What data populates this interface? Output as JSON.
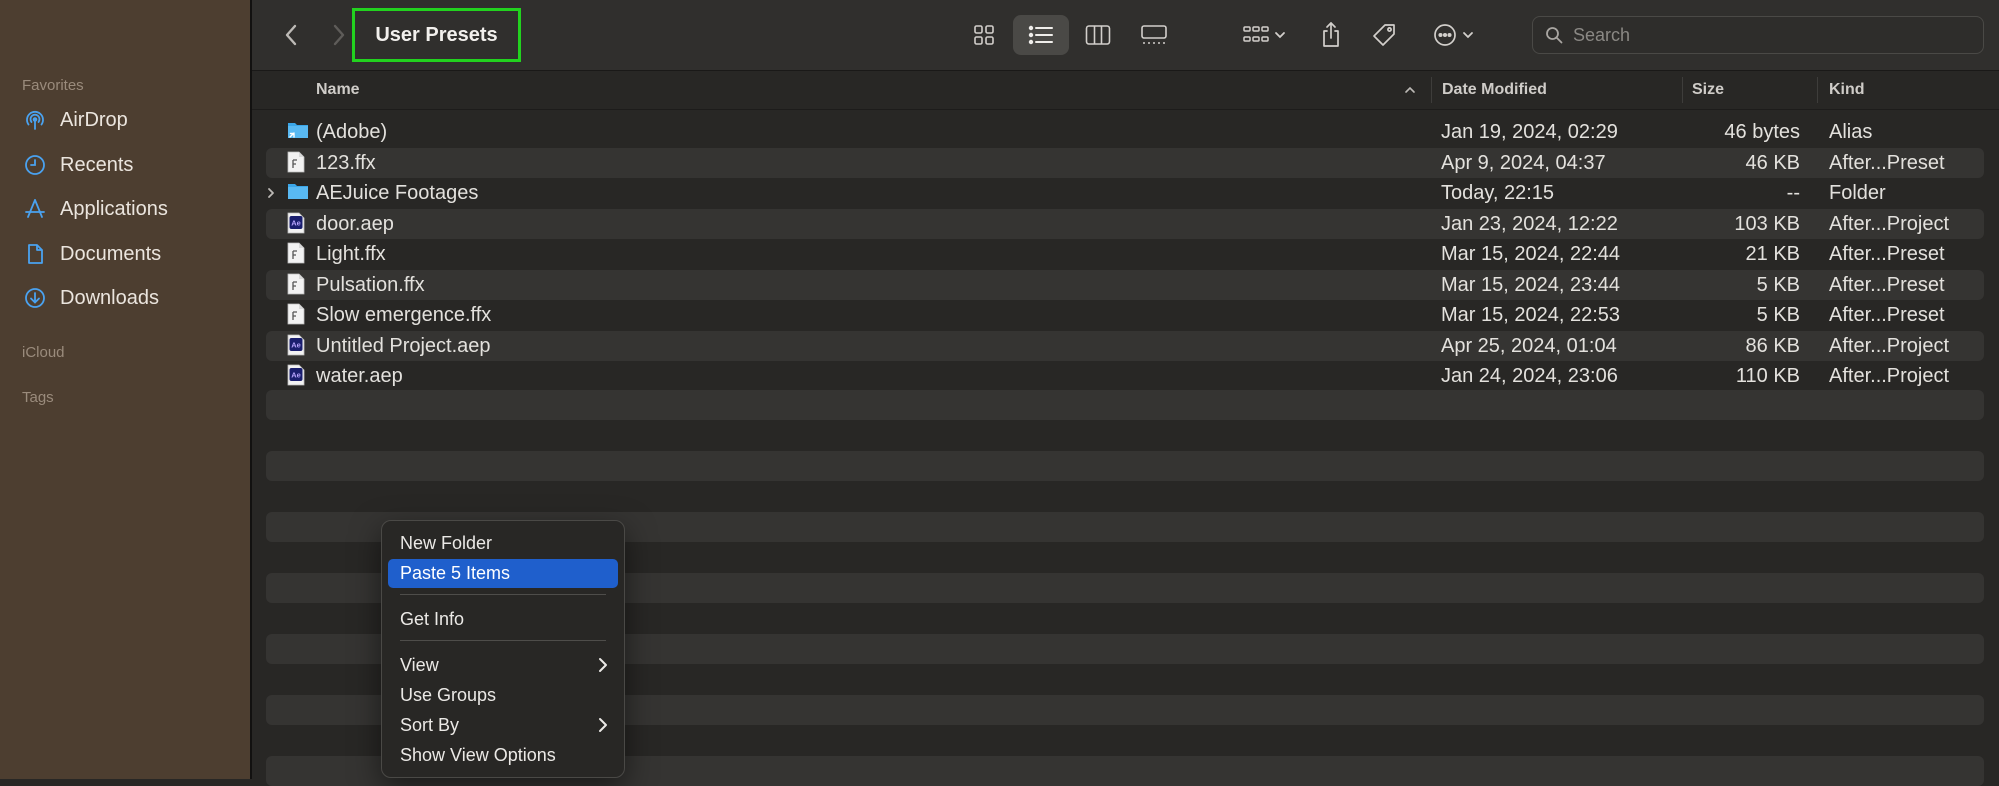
{
  "window": {
    "title": "User Presets"
  },
  "sidebar": {
    "sections": [
      {
        "label": "Favorites"
      },
      {
        "label": "iCloud"
      },
      {
        "label": "Tags"
      }
    ],
    "items": [
      {
        "label": "AirDrop",
        "icon": "airdrop-icon"
      },
      {
        "label": "Recents",
        "icon": "clock-icon"
      },
      {
        "label": "Applications",
        "icon": "applications-icon"
      },
      {
        "label": "Documents",
        "icon": "document-icon"
      },
      {
        "label": "Downloads",
        "icon": "download-icon"
      }
    ]
  },
  "toolbar": {
    "search_placeholder": "Search",
    "view_modes": [
      "icon-view",
      "list-view",
      "column-view",
      "gallery-view"
    ],
    "selected_view": "list-view"
  },
  "columns": {
    "name": "Name",
    "date": "Date Modified",
    "size": "Size",
    "kind": "Kind"
  },
  "files": [
    {
      "name": "(Adobe)",
      "date": "Jan 19, 2024, 02:29",
      "size": "46 bytes",
      "kind": "Alias",
      "icon": "folder-alias-icon"
    },
    {
      "name": "123.ffx",
      "date": "Apr 9, 2024, 04:37",
      "size": "46 KB",
      "kind": "After...Preset",
      "icon": "ffx-file-icon"
    },
    {
      "name": "AEJuice Footages",
      "date": "Today, 22:15",
      "size": "--",
      "kind": "Folder",
      "icon": "folder-icon"
    },
    {
      "name": "door.aep",
      "date": "Jan 23, 2024, 12:22",
      "size": "103 KB",
      "kind": "After...Project",
      "icon": "aep-file-icon"
    },
    {
      "name": "Light.ffx",
      "date": "Mar 15, 2024, 22:44",
      "size": "21 KB",
      "kind": "After...Preset",
      "icon": "ffx-file-icon"
    },
    {
      "name": "Pulsation.ffx",
      "date": "Mar 15, 2024, 23:44",
      "size": "5 KB",
      "kind": "After...Preset",
      "icon": "ffx-file-icon"
    },
    {
      "name": "Slow emergence.ffx",
      "date": "Mar 15, 2024, 22:53",
      "size": "5 KB",
      "kind": "After...Preset",
      "icon": "ffx-file-icon"
    },
    {
      "name": "Untitled Project.aep",
      "date": "Apr 25, 2024, 01:04",
      "size": "86 KB",
      "kind": "After...Project",
      "icon": "aep-file-icon"
    },
    {
      "name": "water.aep",
      "date": "Jan 24, 2024, 23:06",
      "size": "110 KB",
      "kind": "After...Project",
      "icon": "aep-file-icon"
    }
  ],
  "ae_badge": "Ae",
  "context_menu": {
    "items": [
      {
        "label": "New Folder"
      },
      {
        "label": "Paste 5 Items",
        "highlighted": true
      },
      {
        "label": "Get Info"
      },
      {
        "label": "View",
        "submenu": true
      },
      {
        "label": "Use Groups"
      },
      {
        "label": "Sort By",
        "submenu": true
      },
      {
        "label": "Show View Options"
      }
    ]
  },
  "colors": {
    "sidebar_bg": "#4d3e30",
    "window_bg": "#282725",
    "accent_highlight": "#1f5fcc",
    "title_outline": "#22d21f",
    "folder_blue": "#3aa6e8",
    "ae_purple": "#1a1e6e"
  }
}
